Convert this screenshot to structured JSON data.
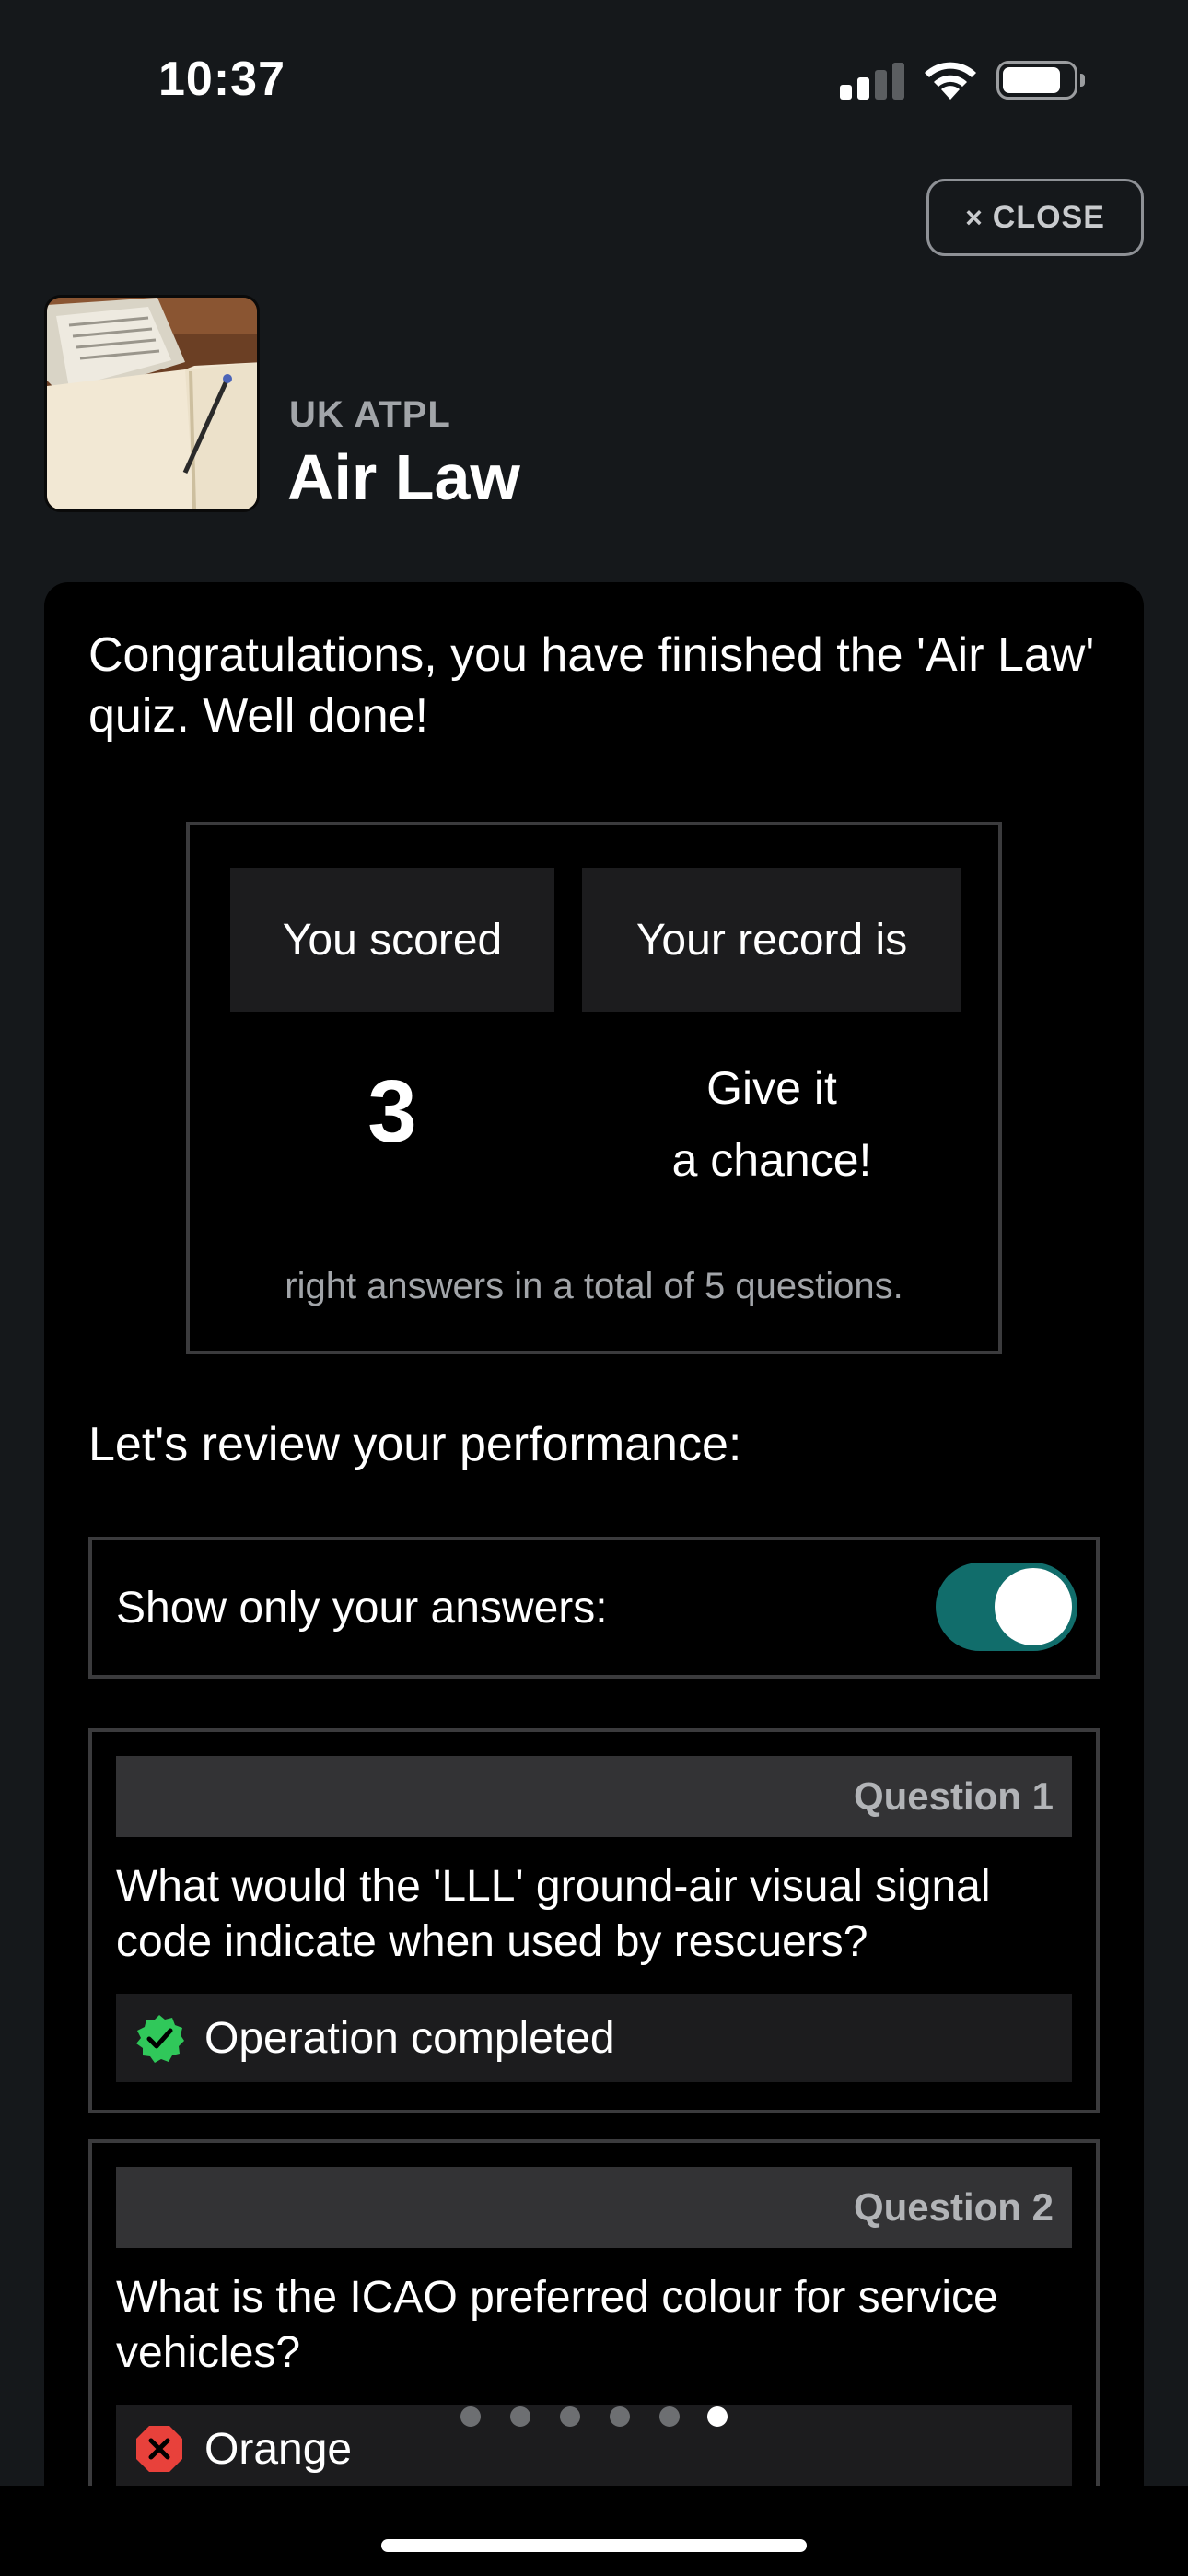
{
  "status_bar": {
    "time": "10:37"
  },
  "close_button": {
    "label": "CLOSE",
    "icon": "×"
  },
  "header": {
    "subject": "UK ATPL",
    "title": "Air Law"
  },
  "result": {
    "congrats": "Congratulations, you have finished the 'Air Law' quiz. Well done!",
    "scored_label": "You scored",
    "record_label": "Your record is",
    "score": "3",
    "record_line1": "Give it",
    "record_line2": "a chance!",
    "footer": "right answers in a total of 5 questions."
  },
  "review": {
    "title": "Let's review your performance:",
    "toggle_label": "Show only your answers:",
    "toggle_on": true
  },
  "questions": [
    {
      "label": "Question 1",
      "text": "What would the 'LLL' ground-air visual signal code indicate when used by rescuers?",
      "answer": "Operation completed",
      "correct": true
    },
    {
      "label": "Question 2",
      "text": "What is the ICAO preferred colour for service vehicles?",
      "answer": "Orange",
      "correct": false
    }
  ],
  "pager": {
    "pages": 6,
    "active_index": 5
  },
  "colors": {
    "accent_toggle": "#116d6b",
    "correct": "#30c85a",
    "incorrect": "#e8413b",
    "background": "#15181b"
  }
}
